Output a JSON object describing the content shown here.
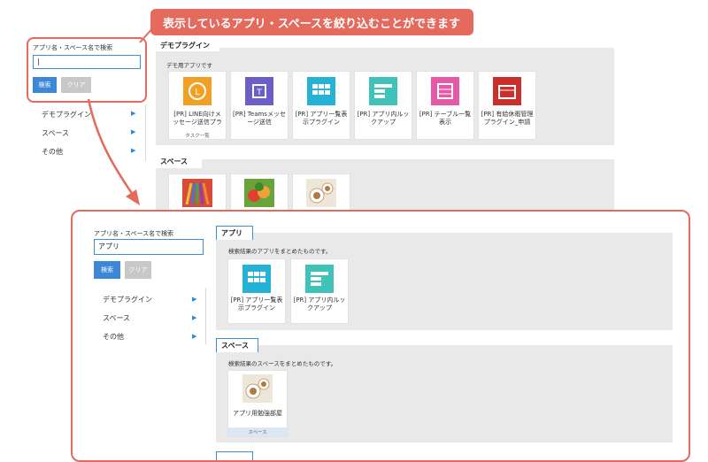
{
  "callout": "表示しているアプリ・スペースを絞り込むことができます",
  "top": {
    "search": {
      "label": "アプリ名・スペース名で検索",
      "value": "|",
      "search_btn": "検索",
      "clear_btn": "クリア"
    },
    "nav": [
      {
        "label": "デモプラグイン"
      },
      {
        "label": "スペース"
      },
      {
        "label": "その他"
      }
    ],
    "demo_section": {
      "title": "デモプラグイン",
      "desc": "デモ用アプリです",
      "apps": [
        {
          "title": "[PR] LINE向けメッセージ送信プラ",
          "foot": "タスク一覧",
          "icon": "clock-icon",
          "color": "#f2a024"
        },
        {
          "title": "[PR] Teamsメッセージ送信",
          "foot": "",
          "icon": "teams-icon",
          "color": "#6b5fc7"
        },
        {
          "title": "[PR] アプリ一覧表示プラグイン",
          "foot": "",
          "icon": "grid-app-icon",
          "color": "#24b3d6"
        },
        {
          "title": "[PR] アプリ内ルックアップ",
          "foot": "",
          "icon": "lookup-icon",
          "color": "#3fc3b9"
        },
        {
          "title": "[PR] テーブル一覧表示",
          "foot": "",
          "icon": "table-icon",
          "color": "#e55aa6"
        },
        {
          "title": "[PR] 有給休暇管理プラグイン_申請",
          "foot": "",
          "icon": "calendar-icon",
          "color": "#c9302c"
        }
      ]
    },
    "space_section": {
      "title": "スペース",
      "thumbs": [
        {
          "name": "pencils-thumb",
          "color": "#d84a3a"
        },
        {
          "name": "vegetables-thumb",
          "color": "#6aa33c"
        },
        {
          "name": "coffee-thumb",
          "color": "#c8a27a"
        }
      ]
    }
  },
  "zoom": {
    "search": {
      "label": "アプリ名・スペース名で検索",
      "value": "アプリ",
      "search_btn": "検索",
      "clear_btn": "クリア"
    },
    "nav": [
      {
        "label": "デモプラグイン"
      },
      {
        "label": "スペース"
      },
      {
        "label": "その他"
      }
    ],
    "apps_section": {
      "title": "アプリ",
      "desc": "検索結果のアプリをまとめたものです。",
      "apps": [
        {
          "title": "[PR] アプリ一覧表示プラグイン",
          "icon": "grid-app-icon",
          "color": "#24b3d6"
        },
        {
          "title": "[PR] アプリ内ルックアップ",
          "icon": "lookup-icon",
          "color": "#3fc3b9"
        }
      ]
    },
    "space_section": {
      "title": "スペース",
      "desc": "検索結果のスペースをまとめたものです。",
      "spaces": [
        {
          "title": "アプリ用勉強部屋",
          "foot": "スペース"
        }
      ]
    }
  },
  "colors": {
    "accent": "#3c87d6",
    "callout": "#e46a5e"
  }
}
